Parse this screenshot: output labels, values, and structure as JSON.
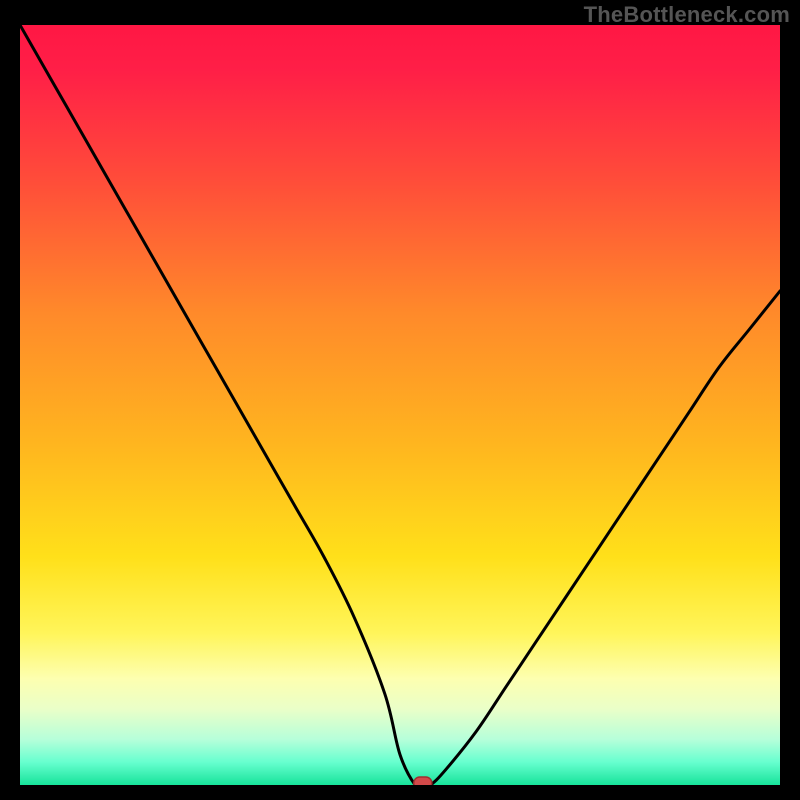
{
  "watermark": "TheBottleneck.com",
  "colors": {
    "frame": "#000000",
    "curve": "#000000",
    "marker_fill": "#d24a4a",
    "marker_stroke": "#a13030",
    "gradient_stops": [
      {
        "offset": 0.0,
        "color": "#ff1744"
      },
      {
        "offset": 0.06,
        "color": "#ff1f47"
      },
      {
        "offset": 0.2,
        "color": "#ff4b3a"
      },
      {
        "offset": 0.38,
        "color": "#ff8a2a"
      },
      {
        "offset": 0.55,
        "color": "#ffb51f"
      },
      {
        "offset": 0.7,
        "color": "#ffe01a"
      },
      {
        "offset": 0.8,
        "color": "#fff55a"
      },
      {
        "offset": 0.86,
        "color": "#fdffb0"
      },
      {
        "offset": 0.9,
        "color": "#eaffc8"
      },
      {
        "offset": 0.94,
        "color": "#b6ffda"
      },
      {
        "offset": 0.97,
        "color": "#67ffcf"
      },
      {
        "offset": 1.0,
        "color": "#17e39a"
      }
    ]
  },
  "chart_data": {
    "type": "line",
    "title": "",
    "xlabel": "",
    "ylabel": "",
    "xlim": [
      0,
      100
    ],
    "ylim": [
      0,
      100
    ],
    "grid": false,
    "legend": false,
    "marker": {
      "x": 53,
      "y": 0
    },
    "series": [
      {
        "name": "bottleneck-curve",
        "x": [
          0,
          4,
          8,
          12,
          16,
          20,
          24,
          28,
          32,
          36,
          40,
          44,
          48,
          50,
          52,
          53,
          54,
          56,
          60,
          64,
          68,
          72,
          76,
          80,
          84,
          88,
          92,
          96,
          100
        ],
        "y": [
          100,
          93,
          86,
          79,
          72,
          65,
          58,
          51,
          44,
          37,
          30,
          22,
          12,
          4,
          0,
          0,
          0,
          2,
          7,
          13,
          19,
          25,
          31,
          37,
          43,
          49,
          55,
          60,
          65
        ]
      }
    ]
  }
}
